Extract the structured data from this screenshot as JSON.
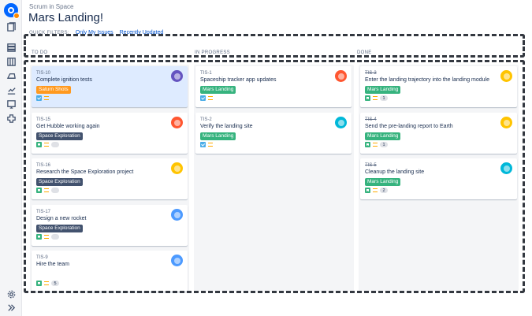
{
  "header": {
    "project_name": "Scrum in Space",
    "board_title": "Mars Landing!"
  },
  "quick_filters": {
    "label": "QUICK FILTERS:",
    "items": [
      "Only My Issues",
      "Recently Updated"
    ]
  },
  "sidebar_icons": [
    "app-logo",
    "backlog-icon",
    "board-icon",
    "releases-icon",
    "reports-icon",
    "issues-icon",
    "components-icon",
    "add-ons-icon",
    "settings-icon",
    "expand-icon"
  ],
  "columns": [
    {
      "title": "TO DO",
      "cards": [
        {
          "key": "TIS-10",
          "summary": "Complete ignition tests",
          "epic": "Saturn Shots",
          "epic_color": "#ff991f",
          "type": "task",
          "points": "",
          "selected": true,
          "avatar_color": "#6554c0",
          "done": false
        },
        {
          "key": "TIS-15",
          "summary": "Get Hubble working again",
          "epic": "Space Exploration",
          "epic_color": "#42526e",
          "type": "story",
          "points": "",
          "selected": false,
          "avatar_color": "#ff5630",
          "done": false
        },
        {
          "key": "TIS-16",
          "summary": "Research the Space Exploration project",
          "epic": "Space Exploration",
          "epic_color": "#42526e",
          "type": "story",
          "points": "",
          "selected": false,
          "avatar_color": "#ffc400",
          "done": false
        },
        {
          "key": "TIS-17",
          "summary": "Design a new rocket",
          "epic": "Space Exploration",
          "epic_color": "#42526e",
          "type": "story",
          "points": "",
          "selected": false,
          "avatar_color": "#4c9aff",
          "done": false
        },
        {
          "key": "TIS-9",
          "summary": "Hire the team",
          "epic": "",
          "epic_color": "",
          "type": "story",
          "points": "5",
          "selected": false,
          "avatar_color": "#4c9aff",
          "done": false
        }
      ]
    },
    {
      "title": "IN PROGRESS",
      "cards": [
        {
          "key": "TIS-1",
          "summary": "Spaceship tracker app updates",
          "epic": "Mars Landing",
          "epic_color": "#36b37e",
          "type": "task",
          "points": "",
          "selected": false,
          "avatar_color": "#ff5630",
          "done": false
        },
        {
          "key": "TIS-2",
          "summary": "Verify the landing site",
          "epic": "Mars Landing",
          "epic_color": "#36b37e",
          "type": "task",
          "points": "",
          "selected": false,
          "avatar_color": "#00b8d9",
          "done": false
        }
      ]
    },
    {
      "title": "DONE",
      "cards": [
        {
          "key": "TIS-3",
          "summary": "Enter the landing trajectory into the landing module",
          "epic": "Mars Landing",
          "epic_color": "#36b37e",
          "type": "story",
          "points": "1",
          "selected": false,
          "avatar_color": "#ffc400",
          "done": true
        },
        {
          "key": "TIS-4",
          "summary": "Send the pre-landing report to Earth",
          "epic": "Mars Landing",
          "epic_color": "#36b37e",
          "type": "story",
          "points": "1",
          "selected": false,
          "avatar_color": "#ffc400",
          "done": true
        },
        {
          "key": "TIS-5",
          "summary": "Cleanup the landing site",
          "epic": "Mars Landing",
          "epic_color": "#36b37e",
          "type": "story",
          "points": "2",
          "selected": false,
          "avatar_color": "#00b8d9",
          "done": true
        }
      ]
    }
  ]
}
